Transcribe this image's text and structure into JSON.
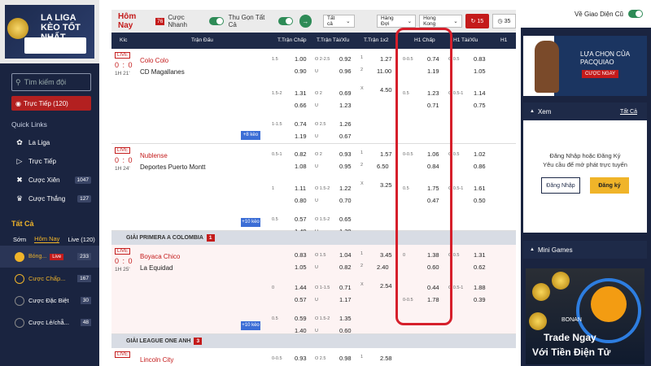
{
  "left": {
    "banner": "LA LIGA KÈO TỐT NHẤT CHÂU Á",
    "search_placeholder": "Tìm kiếm đội",
    "live_button": "Trực Tiếp (120)",
    "quick_links_title": "Quick Links",
    "quick_links": [
      {
        "label": "La Liga",
        "icon": "boot-icon",
        "count": ""
      },
      {
        "label": "Trực Tiếp",
        "icon": "play-icon",
        "count": ""
      },
      {
        "label": "Cược Xiên",
        "icon": "parlay-icon",
        "count": "1047"
      },
      {
        "label": "Cược Thắng",
        "icon": "trophy-icon",
        "count": "127"
      }
    ],
    "all_title": "Tất Cả",
    "tabs": [
      "Sớm",
      "Hôm Nay",
      "Live (120)"
    ],
    "sports": [
      {
        "label": "Bóng...",
        "live": "Live",
        "count": "233"
      },
      {
        "label": "Cược Chấp...",
        "live": "",
        "count": "167"
      },
      {
        "label": "Cược Đặc Biệt",
        "live": "",
        "count": "30"
      },
      {
        "label": "Cược Lẻ/chẵ...",
        "live": "",
        "count": "48"
      }
    ]
  },
  "topbar": {
    "title": "Hôm Nay",
    "badge": "76",
    "quick_bet": "Cược Nhanh",
    "collapse_all": "Thu Gọn Tất Cả",
    "filter_all": "Tất cả",
    "sort": "Hàng Đợi",
    "odds_type": "Hong Kong",
    "refresh_count": "15",
    "other_count": "35"
  },
  "columns": [
    "Kíc",
    "Trận Đấu",
    "T.Trận Chấp",
    "T.Trận Tài/Xỉu",
    "T.Trận 1x2",
    "H1 Chấp",
    "H1 Tài/Xỉu",
    "H1"
  ],
  "leagues": [
    {
      "name": "GIẢI PRIMERA A COLOMBIA",
      "count": "1"
    },
    {
      "name": "GIẢI LEAGUE ONE ANH",
      "count": "3"
    }
  ],
  "matches": [
    {
      "live": "LIVE",
      "score": "0 : 0",
      "time": "1H 21'",
      "home": "Colo Colo",
      "away": "CD Magallanes",
      "more": "+8 kèo",
      "rows": [
        {
          "hl": "1.5",
          "h1": "1.00",
          "h2": "0.90",
          "ol": "O 2-2.5",
          "o1": "0.92",
          "u": "U",
          "o2": "0.96",
          "x1": "1",
          "x1v": "1.27",
          "x2": "2",
          "x2v": "11.00",
          "x3": "X",
          "x3v": "4.50",
          "fl": "0-0.5",
          "f1": "0.74",
          "f2": "1.19",
          "gl": "O 0.5",
          "g1": "0.83",
          "g2": "1.05"
        },
        {
          "hl": "1.5-2",
          "h1": "1.31",
          "h2": "0.66",
          "ol": "O 2",
          "o1": "0.69",
          "u": "U",
          "o2": "1.23",
          "fl": "0.5",
          "f1": "1.23",
          "f2": "0.71",
          "gl": "O 0.5-1",
          "g1": "1.14",
          "g2": "0.75"
        },
        {
          "hl": "1-1.5",
          "h1": "0.74",
          "h2": "1.19",
          "ol": "O 2.5",
          "o1": "1.26",
          "u": "U",
          "o2": "0.67"
        }
      ]
    },
    {
      "live": "LIVE",
      "score": "0 : 0",
      "time": "1H 24'",
      "home": "Nublense",
      "away": "Deportes Puerto Montt",
      "more": "+10 kèo",
      "rows": [
        {
          "hl": "0.5-1",
          "h1": "0.82",
          "h2": "1.08",
          "ol": "O 2",
          "o1": "0.93",
          "u": "U",
          "o2": "0.95",
          "x1": "1",
          "x1v": "1.57",
          "x2": "2",
          "x2v": "6.50",
          "x3": "X",
          "x3v": "3.25",
          "fl": "0-0.5",
          "f1": "1.06",
          "f2": "0.84",
          "gl": "O 0.5",
          "g1": "1.02",
          "g2": "0.86"
        },
        {
          "hl": "1",
          "h1": "1.11",
          "h2": "0.80",
          "ol": "O 1.5-2",
          "o1": "1.22",
          "u": "U",
          "o2": "0.70",
          "fl": "0.5",
          "f1": "1.75",
          "f2": "0.47",
          "gl": "O 0.5-1",
          "g1": "1.61",
          "g2": "0.50"
        },
        {
          "hl": "0.5",
          "h1": "0.57",
          "h2": "1.49",
          "ol": "O 1.5-2",
          "o1": "0.65",
          "u": "U",
          "o2": "1.29"
        }
      ]
    },
    {
      "live": "LIVE",
      "score": "0 : 0",
      "time": "1H 25'",
      "home": "Boyaca Chico",
      "away": "La Equidad",
      "more": "+10 kèo",
      "rows": [
        {
          "hl": "",
          "h1": "0.83",
          "h2": "1.05",
          "ol": "O 1.5",
          "o1": "1.04",
          "u": "U",
          "o2": "0.82",
          "x1": "1",
          "x1v": "3.45",
          "x2": "2",
          "x2v": "2.40",
          "x3": "X",
          "x3v": "2.54",
          "fl": "0",
          "f1": "1.38",
          "f2": "0.60",
          "gl": "O 0.5",
          "g1": "1.31",
          "g2": "0.62"
        },
        {
          "hl": "0",
          "h1": "1.44",
          "h2": "0.57",
          "ol": "O 1-1.5",
          "o1": "0.71",
          "u": "U",
          "o2": "1.17",
          "fl": "",
          "f1": "0.44",
          "f2": "1.78",
          "fl2": "0-0.5",
          "gl": "O 0.5-1",
          "g1": "1.88",
          "g2": "0.39"
        },
        {
          "hl": "0.5",
          "h1": "0.59",
          "h2": "1.40",
          "ol": "O 1.5-2",
          "o1": "1.35",
          "u": "U",
          "o2": "0.60"
        }
      ]
    },
    {
      "live": "LIVE",
      "score": "",
      "time": "",
      "home": "Lincoln City",
      "away": "",
      "more": "",
      "rows": [
        {
          "hl": "0-0.5",
          "h1": "0.93",
          "h2": "",
          "ol": "O 2.5",
          "o1": "0.98",
          "u": "",
          "o2": "",
          "x1": "1",
          "x1v": "2.58"
        }
      ]
    }
  ],
  "right": {
    "interface_label": "Về Giao Diện Cũ",
    "banner_text": "LỰA CHỌN CỦA PACQUIAO",
    "banner_cta": "CƯỢC NGAY",
    "watch_title": "Xem",
    "watch_all": "Tất Cả",
    "login_text1": "Đăng Nhập hoặc Đăng Ký",
    "login_text2": "Yêu cầu để mở phát trực tuyến",
    "login_btn": "Đăng Nhập",
    "register_btn": "Đăng ký",
    "minigames_title": "Mini Games",
    "mg_small": "BONAN",
    "mg_line1": "Trade Ngay",
    "mg_line2": "Với Tiền Điện Tử"
  },
  "colors": {
    "brand_red": "#c41b1b",
    "navy": "#1a2440",
    "highlight": "#d61f2b",
    "gold": "#f0b429"
  }
}
